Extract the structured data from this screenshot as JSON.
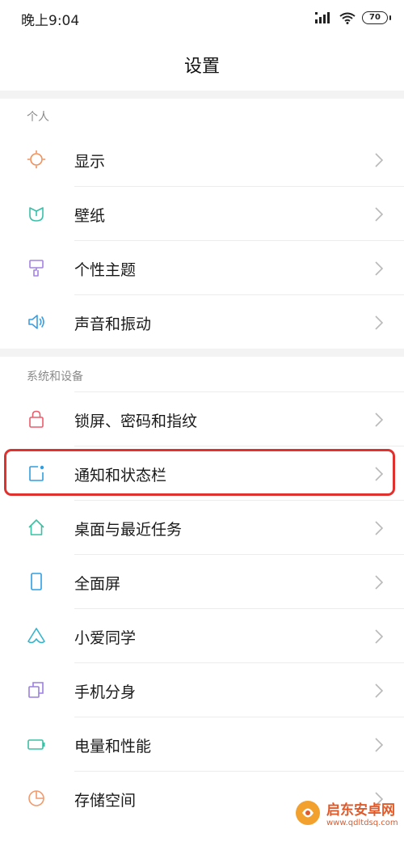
{
  "status_bar": {
    "time": "晚上9:04",
    "battery": "70"
  },
  "page": {
    "title": "设置"
  },
  "sections": [
    {
      "header": "个人",
      "items": [
        {
          "label": "显示",
          "icon": "display-icon",
          "color": "#f0905a"
        },
        {
          "label": "壁纸",
          "icon": "wallpaper-icon",
          "color": "#3cbfa9"
        },
        {
          "label": "个性主题",
          "icon": "theme-icon",
          "color": "#a483e0"
        },
        {
          "label": "声音和振动",
          "icon": "sound-icon",
          "color": "#3a9ee0"
        }
      ]
    },
    {
      "header": "系统和设备",
      "items": [
        {
          "label": "锁屏、密码和指纹",
          "icon": "lock-icon",
          "color": "#ec5b6b"
        },
        {
          "label": "通知和状态栏",
          "icon": "notification-icon",
          "color": "#2f9fe0"
        },
        {
          "label": "桌面与最近任务",
          "icon": "home-icon",
          "color": "#3cc0a4"
        },
        {
          "label": "全面屏",
          "icon": "fullscreen-icon",
          "color": "#2d9fe2"
        },
        {
          "label": "小爱同学",
          "icon": "xiaoai-icon",
          "color": "#34b4cc"
        },
        {
          "label": "手机分身",
          "icon": "clone-icon",
          "color": "#9b7fe0"
        },
        {
          "label": "电量和性能",
          "icon": "battery-icon",
          "color": "#3cc0a4"
        },
        {
          "label": "存储空间",
          "icon": "storage-icon",
          "color": "#f39a6a"
        }
      ]
    }
  ],
  "watermark": {
    "title": "启东安卓网",
    "url": "www.qdltdsq.com"
  }
}
